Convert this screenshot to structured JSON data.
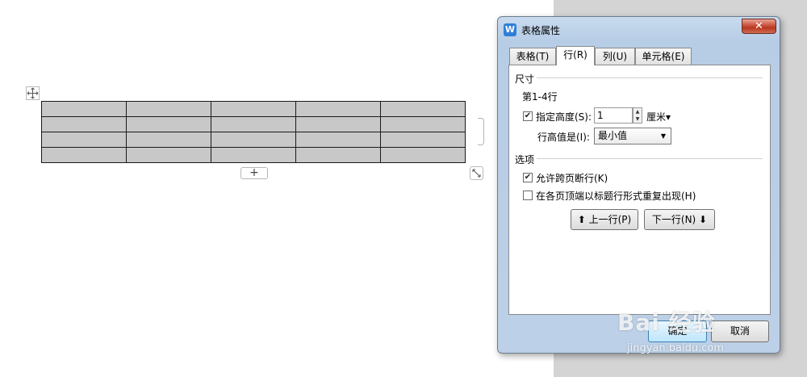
{
  "dialog": {
    "title": "表格属性",
    "icon_letter": "W",
    "close_label": "✕",
    "tabs": [
      {
        "label": "表格(T)"
      },
      {
        "label": "行(R)"
      },
      {
        "label": "列(U)"
      },
      {
        "label": "单元格(E)"
      }
    ],
    "active_tab": "行(R)",
    "size_section": {
      "label": "尺寸",
      "rows_label": "第1-4行",
      "specify_height_label": "指定高度(S):",
      "specify_height_checked": true,
      "height_value": "1",
      "height_unit": "厘米▾",
      "row_height_is_label": "行高值是(I):",
      "row_height_is_value": "最小值"
    },
    "options_section": {
      "label": "选项",
      "allow_break_label": "允许跨页断行(K)",
      "allow_break_checked": true,
      "repeat_header_label": "在各页顶端以标题行形式重复出现(H)",
      "repeat_header_checked": false
    },
    "prev_row_button": "⬆ 上一行(P)",
    "next_row_button": "下一行(N) ⬇",
    "ok_button": "确定",
    "cancel_button": "取消"
  },
  "document": {
    "table_rows": 4,
    "table_cols": 5,
    "add_row_label": "+"
  },
  "watermark": {
    "logo": "Bai 经验",
    "url": "jingyan.baidu.com"
  }
}
